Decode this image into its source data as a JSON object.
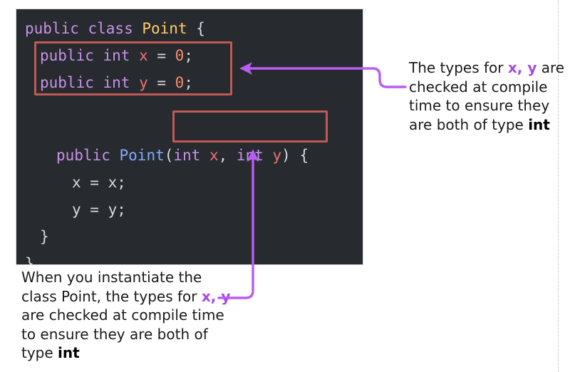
{
  "code": {
    "language": "java",
    "lines": [
      {
        "id": "class-decl",
        "tokens": [
          {
            "text": "public class ",
            "kind": "keyword"
          },
          {
            "text": "Point",
            "kind": "type"
          },
          {
            "text": " {",
            "kind": "plain"
          }
        ]
      },
      {
        "id": "field-x",
        "tokens": [
          {
            "text": "public int ",
            "kind": "keyword"
          },
          {
            "text": "x",
            "kind": "variable"
          },
          {
            "text": " = ",
            "kind": "plain"
          },
          {
            "text": "0",
            "kind": "number"
          },
          {
            "text": ";",
            "kind": "plain"
          }
        ]
      },
      {
        "id": "field-y",
        "tokens": [
          {
            "text": "public int ",
            "kind": "keyword"
          },
          {
            "text": "y",
            "kind": "variable"
          },
          {
            "text": " = ",
            "kind": "plain"
          },
          {
            "text": "0",
            "kind": "number"
          },
          {
            "text": ";",
            "kind": "plain"
          }
        ]
      },
      {
        "id": "ctor-decl",
        "tokens": [
          {
            "text": "public ",
            "kind": "keyword"
          },
          {
            "text": "Point",
            "kind": "function"
          },
          {
            "text": "(",
            "kind": "plain"
          },
          {
            "text": "int ",
            "kind": "keyword"
          },
          {
            "text": "x",
            "kind": "variable"
          },
          {
            "text": ", ",
            "kind": "plain"
          },
          {
            "text": "int ",
            "kind": "keyword"
          },
          {
            "text": "y",
            "kind": "variable"
          },
          {
            "text": ") {",
            "kind": "plain"
          }
        ]
      },
      {
        "id": "assign-x",
        "tokens": [
          {
            "text": "x = x;",
            "kind": "plain"
          }
        ]
      },
      {
        "id": "assign-y",
        "tokens": [
          {
            "text": "y = y;",
            "kind": "plain"
          }
        ]
      },
      {
        "id": "close-ctor",
        "tokens": [
          {
            "text": "}",
            "kind": "plain"
          }
        ]
      },
      {
        "id": "close-class",
        "tokens": [
          {
            "text": "}",
            "kind": "plain"
          }
        ]
      }
    ],
    "plain_text": "public class Point {\n  public int x = 0;\n  public int y = 0;\n\n  public Point(int x, int y) {\n    x = x;\n    y = y;\n  }\n}"
  },
  "highlights": [
    {
      "id": "fields-box",
      "label": "field declarations highlight",
      "color": "#c05a52"
    },
    {
      "id": "params-box",
      "label": "constructor parameters highlight",
      "color": "#c05a52"
    }
  ],
  "annotations": {
    "top": {
      "segments": [
        {
          "text": "The types for ",
          "style": "normal"
        },
        {
          "text": "x, y",
          "style": "purple-bold"
        },
        {
          "text": " are checked at compile time to ensure they are both of type ",
          "style": "normal"
        },
        {
          "text": "int",
          "style": "bold"
        }
      ],
      "plain_text": "The types for x, y are checked at compile time to ensure they are both of type int"
    },
    "bottom": {
      "segments": [
        {
          "text": "When you instantiate the class Point, the types for ",
          "style": "normal"
        },
        {
          "text": "x, y",
          "style": "purple-bold"
        },
        {
          "text": " are checked at compile time to ensure they are both of type ",
          "style": "normal"
        },
        {
          "text": "int",
          "style": "bold"
        }
      ],
      "plain_text": "When you instantiate the class Point, the types for x, y are checked at compile time to ensure they are both of type int"
    }
  },
  "arrows": [
    {
      "id": "arrow-to-fields",
      "from": "annotation-top",
      "to": "fields-box",
      "color": "#b95cf5",
      "shape": "elbow-left"
    },
    {
      "id": "arrow-to-params",
      "from": "annotation-bottom",
      "to": "params-box",
      "color": "#b95cf5",
      "shape": "elbow-up"
    }
  ],
  "colors": {
    "code_background": "#272a2e",
    "page_background": "#ffffff",
    "highlight_red": "#c05a52",
    "arrow_purple": "#b95cf5",
    "keyword": "#c792ea",
    "type_name": "#ffcb6b",
    "function_name": "#82aaff",
    "variable": "#f07178",
    "number": "#f78c6c",
    "plain_code": "#d6dae0",
    "annotation_text": "#1a1a1a",
    "annotation_accent": "#a84ae0",
    "guide_line": "#c9c9c9"
  }
}
